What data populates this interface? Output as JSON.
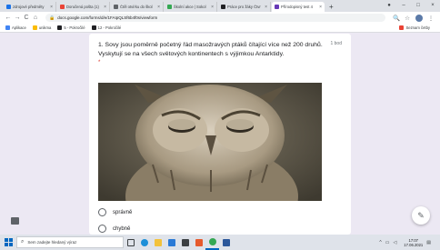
{
  "browser": {
    "tabs": [
      {
        "label": "zdrojové předměty",
        "color": "#1a73e8"
      },
      {
        "label": "Doručená pošta (1)",
        "color": "#ea4335"
      },
      {
        "label": "Čtěl otvírku do škol",
        "color": "#5f6368"
      },
      {
        "label": "Školní akce | Sokol",
        "color": "#34a853"
      },
      {
        "label": "Práce pro žáky Čtvr",
        "color": "#202124"
      },
      {
        "label": "Přírodopisný test 4",
        "color": "#673ab7"
      }
    ],
    "new_tab_label": "+",
    "url": "docs.google.com/forms/d/e/1FAIpQLSf6b4f0s/viewform",
    "bookmarks": [
      {
        "label": "Aplikace",
        "color": "#4285f4"
      },
      {
        "label": "unikma",
        "color": "#fbbc05"
      },
      {
        "label": "5 - Pokročilé",
        "color": "#202124"
      },
      {
        "label": "12 - Pokročilé",
        "color": "#202124"
      }
    ],
    "bookmark_right": "Seznam četby"
  },
  "form": {
    "question": "1. Sovy jsou poměrně početný řád masožravých ptáků čítající více než 200 druhů. Vyskytují se na všech světových kontinentech s výjimkou Antarktidy.",
    "required_mark": "*",
    "points": "1 bod",
    "image_icon": "owl-photo",
    "options": [
      "správně",
      "chybně"
    ]
  },
  "taskbar": {
    "search_placeholder": "Sem zadejte hledaný výraz",
    "time": "17:07",
    "date": "17.06.2021"
  }
}
